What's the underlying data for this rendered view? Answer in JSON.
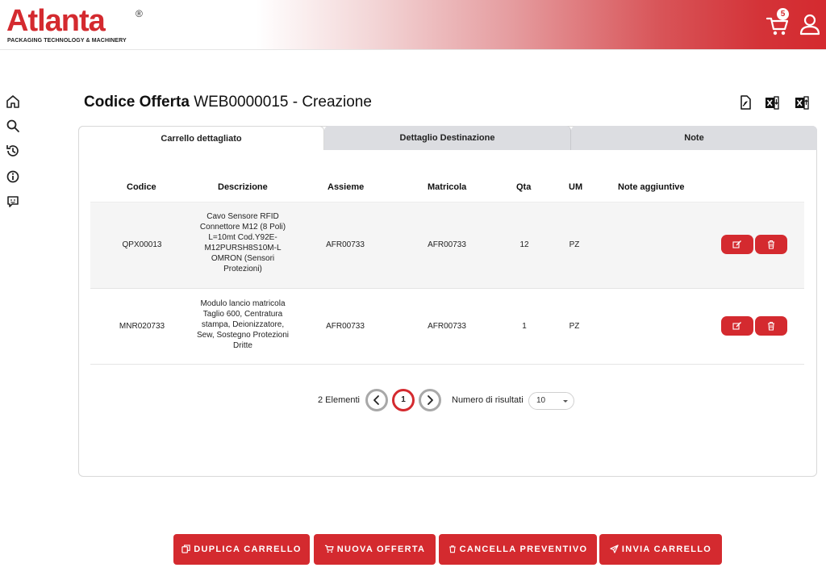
{
  "brand": {
    "name": "Atlanta",
    "registered": "®",
    "tagline": "PACKAGING TECHNOLOGY & MACHINERY",
    "color": "#d42a2f"
  },
  "header": {
    "cart_count": "5"
  },
  "sidebar": {
    "icons": [
      "home-icon",
      "search-icon",
      "history-icon",
      "info-icon",
      "feedback-icon"
    ]
  },
  "page": {
    "title_prefix": "Codice Offerta",
    "title_code": "WEB0000015 - Creazione",
    "export_icons": [
      "pdf-icon",
      "excel-import-icon",
      "excel-export-icon"
    ]
  },
  "tabs": [
    {
      "label": "Carrello dettagliato",
      "active": true
    },
    {
      "label": "Dettaglio Destinazione",
      "active": false
    },
    {
      "label": "Note",
      "active": false
    }
  ],
  "table": {
    "columns": [
      "Codice",
      "Descrizione",
      "Assieme",
      "Matricola",
      "Qta",
      "UM",
      "Note aggiuntive"
    ],
    "rows": [
      {
        "codice": "QPX00013",
        "descrizione": [
          "Cavo Sensore RFID",
          "Connettore M12 (8 Poli)",
          "L=10mt Cod.Y92E-",
          "M12PURSH8S10M-L",
          "OMRON (Sensori",
          "Protezioni)"
        ],
        "assieme": "AFR00733",
        "matricola": "AFR00733",
        "qta": "12",
        "um": "PZ",
        "note": ""
      },
      {
        "codice": "MNR020733",
        "descrizione": [
          "Modulo lancio matricola",
          "Taglio 600, Centratura",
          "stampa, Deionizzatore,",
          "Sew, Sostegno Protezioni",
          "Dritte"
        ],
        "assieme": "AFR00733",
        "matricola": "AFR00733",
        "qta": "1",
        "um": "PZ",
        "note": ""
      }
    ]
  },
  "pagination": {
    "count_label": "2 Elementi",
    "current_page": "1",
    "results_label": "Numero di risultati",
    "page_size": "10"
  },
  "actions": [
    {
      "label": "DUPLICA CARRELLO",
      "icon": "copy-icon"
    },
    {
      "label": "NUOVA OFFERTA",
      "icon": "cart-icon"
    },
    {
      "label": "CANCELLA PREVENTIVO",
      "icon": "trash-icon"
    },
    {
      "label": "INVIA CARRELLO",
      "icon": "send-icon"
    }
  ]
}
